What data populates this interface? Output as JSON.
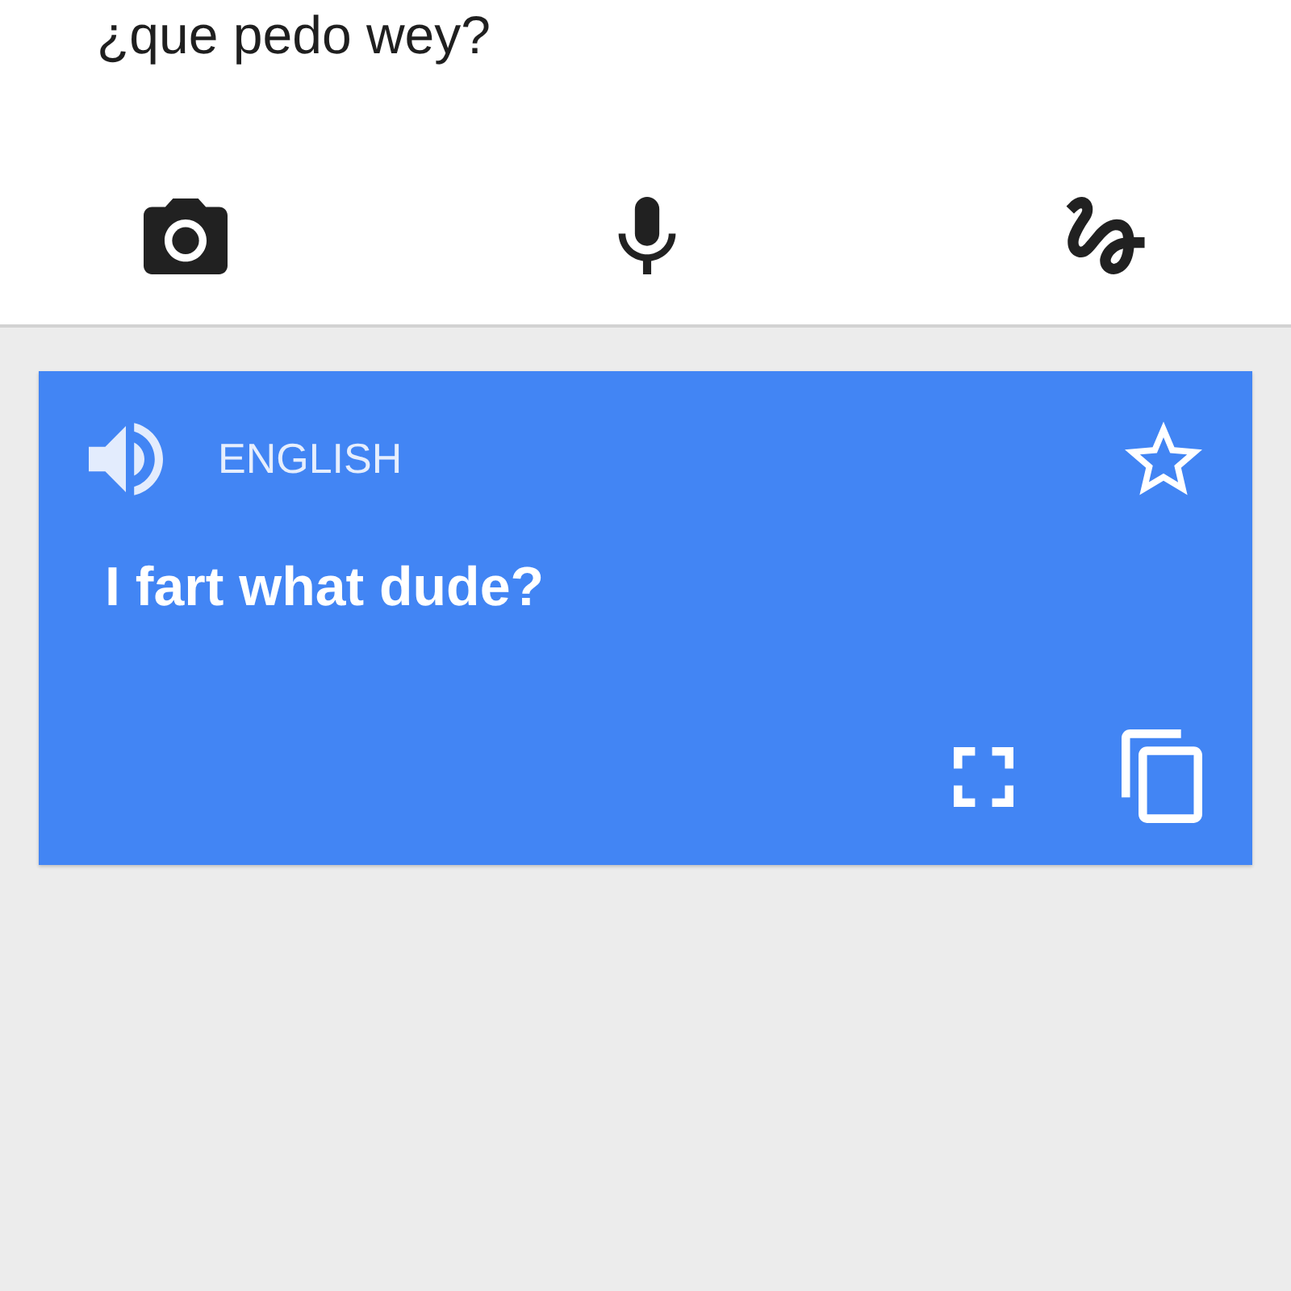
{
  "source": {
    "text": "¿que pedo wey?"
  },
  "translation": {
    "language": "ENGLISH",
    "text": "I fart what dude?",
    "starred": false
  }
}
